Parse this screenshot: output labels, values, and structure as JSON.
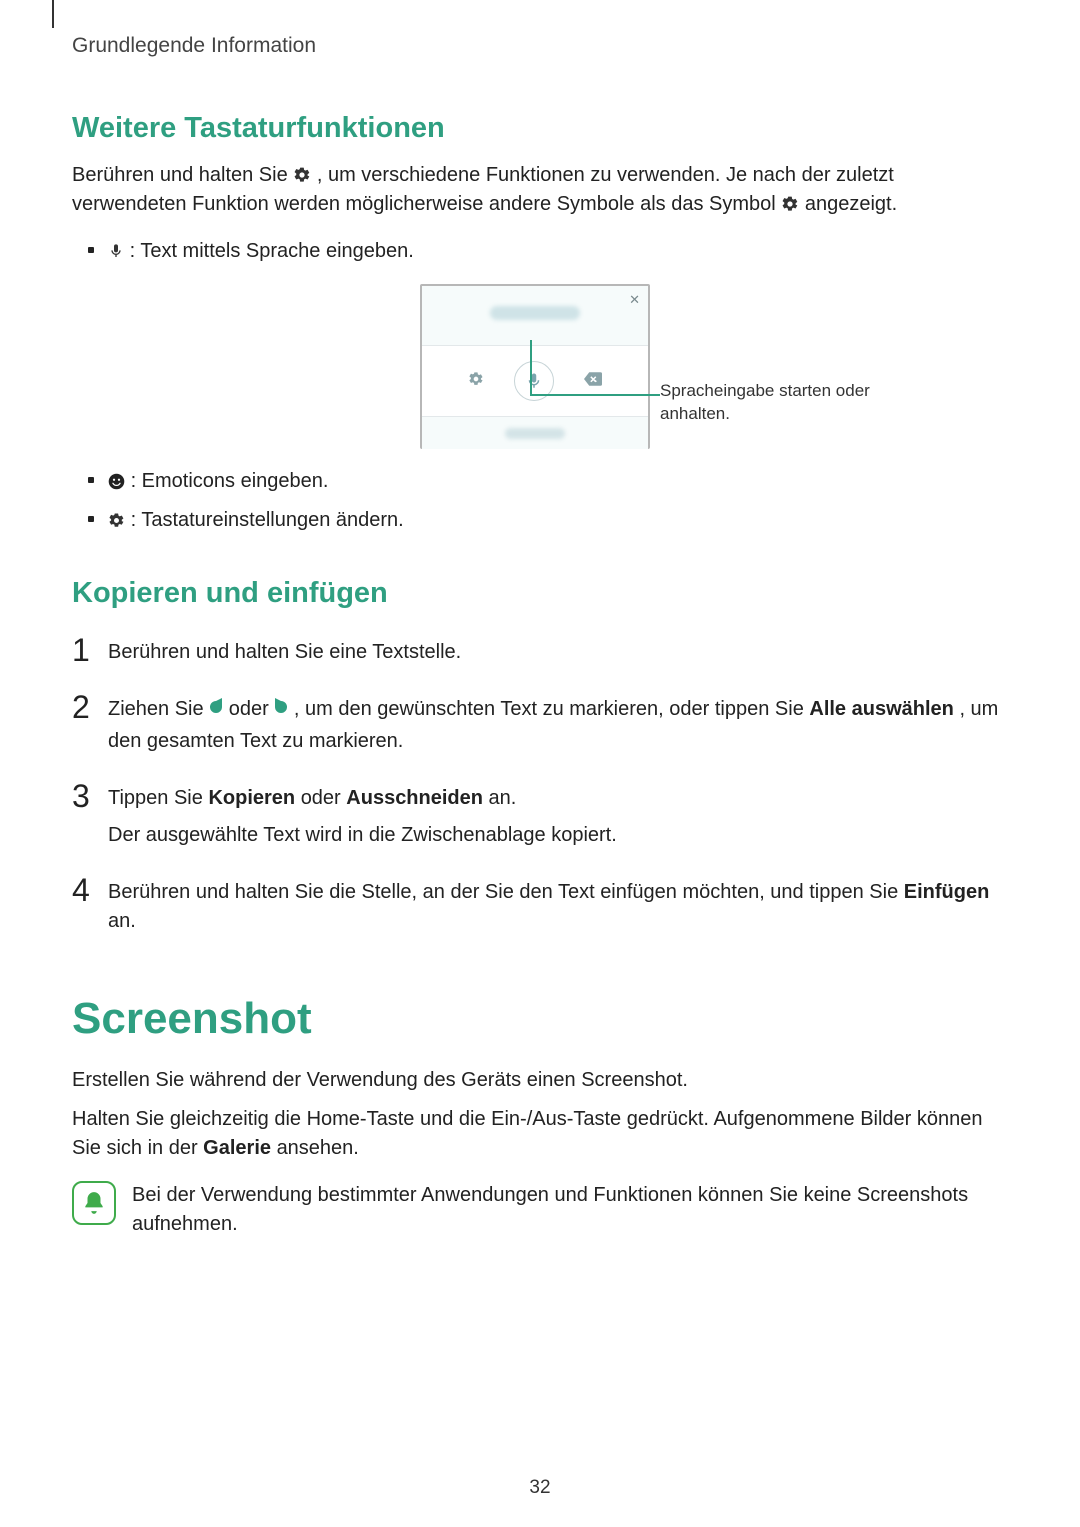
{
  "breadcrumb": "Grundlegende Information",
  "section1": {
    "heading": "Weitere Tastaturfunktionen",
    "intro_pre": "Berühren und halten Sie ",
    "intro_mid": ", um verschiedene Funktionen zu verwenden. Je nach der zuletzt verwendeten Funktion werden möglicherweise andere Symbole als das Symbol ",
    "intro_post": " angezeigt.",
    "bullets": {
      "voice": " : Text mittels Sprache eingeben.",
      "emoji": " : Emoticons eingeben.",
      "settings": " : Tastatureinstellungen ändern."
    },
    "callout": "Spracheingabe starten oder anhalten."
  },
  "section2": {
    "heading": "Kopieren und einfügen",
    "steps": {
      "s1": "Berühren und halten Sie eine Textstelle.",
      "s2_pre": "Ziehen Sie ",
      "s2_mid": " oder ",
      "s2_post_a": ", um den gewünschten Text zu markieren, oder tippen Sie ",
      "s2_bold": "Alle auswählen",
      "s2_post_b": ", um den gesamten Text zu markieren.",
      "s3_a": "Tippen Sie ",
      "s3_b1": "Kopieren",
      "s3_c": " oder ",
      "s3_b2": "Ausschneiden",
      "s3_d": " an.",
      "s3_sub": "Der ausgewählte Text wird in die Zwischenablage kopiert.",
      "s4_a": "Berühren und halten Sie die Stelle, an der Sie den Text einfügen möchten, und tippen Sie ",
      "s4_b": "Einfügen",
      "s4_c": " an."
    }
  },
  "section3": {
    "heading": "Screenshot",
    "p1": "Erstellen Sie während der Verwendung des Geräts einen Screenshot.",
    "p2_a": "Halten Sie gleichzeitig die Home-Taste und die Ein-/Aus-Taste gedrückt. Aufgenommene Bilder können Sie sich in der ",
    "p2_bold": "Galerie",
    "p2_b": " ansehen.",
    "note": "Bei der Verwendung bestimmter Anwendungen und Funktionen können Sie keine Screenshots aufnehmen."
  },
  "page_number": "32"
}
